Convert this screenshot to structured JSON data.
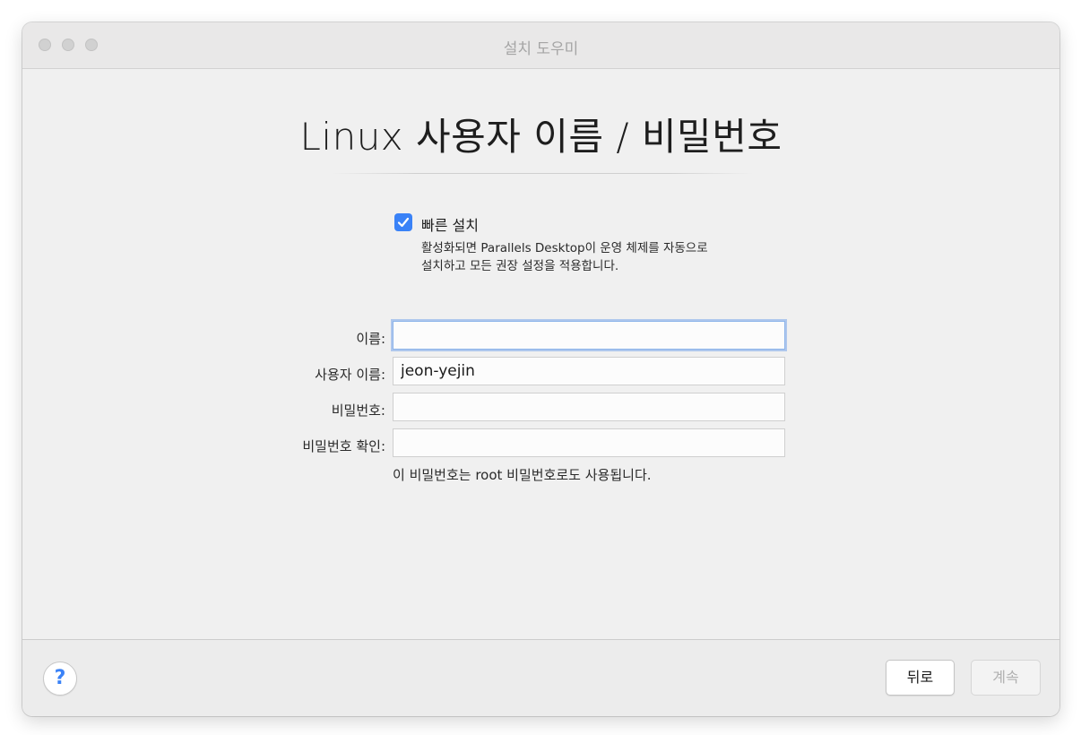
{
  "window": {
    "title": "설치 도우미"
  },
  "page": {
    "title": "Linux 사용자 이름 / 비밀번호"
  },
  "quick_install": {
    "checked": true,
    "label": "빠른 설치",
    "description_line1": "활성화되면 Parallels Desktop이 운영 체제를 자동으로",
    "description_line2": "설치하고 모든 권장 설정을 적용합니다."
  },
  "form": {
    "name": {
      "label": "이름:",
      "value": ""
    },
    "username": {
      "label": "사용자 이름:",
      "value": "jeon-yejin"
    },
    "password": {
      "label": "비밀번호:",
      "value": ""
    },
    "password_confirm": {
      "label": "비밀번호 확인:",
      "value": ""
    },
    "note": "이 비밀번호는 root 비밀번호로도 사용됩니다."
  },
  "footer": {
    "help_label": "?",
    "back_label": "뒤로",
    "continue_label": "계속"
  },
  "colors": {
    "accent": "#3a82f7",
    "disabled_text": "#b0b0b0"
  }
}
